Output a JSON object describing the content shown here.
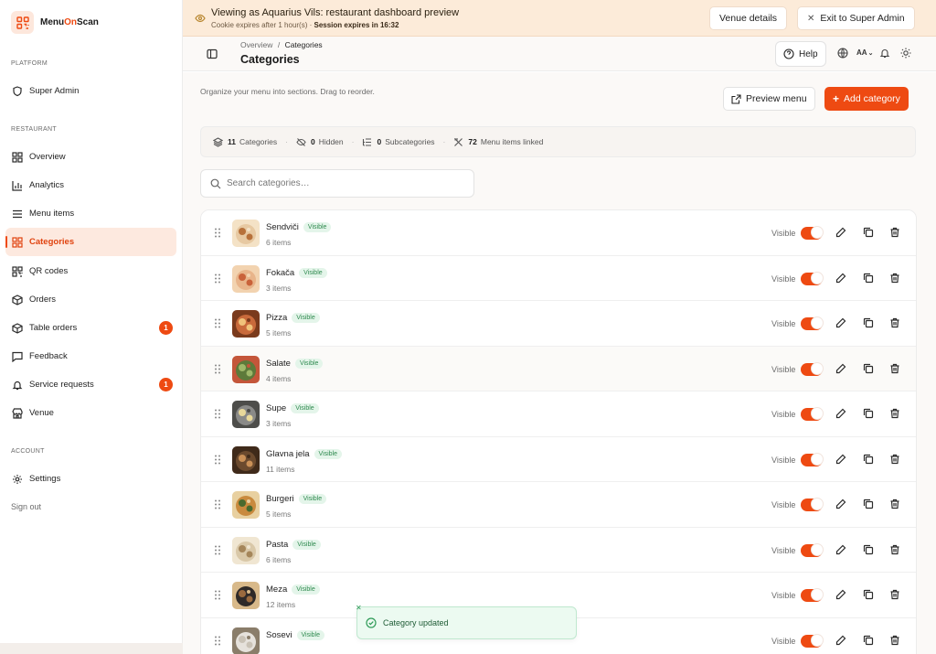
{
  "brand": {
    "name_prefix": "Menu",
    "name_accent": "On",
    "name_suffix": "Scan"
  },
  "sidebar": {
    "sections": {
      "platform": "PLATFORM",
      "restaurant": "RESTAURANT",
      "account": "ACCOUNT"
    },
    "platform_items": [
      {
        "label": "Super Admin",
        "icon": "shield-icon"
      }
    ],
    "restaurant_items": [
      {
        "label": "Overview",
        "icon": "grid-icon"
      },
      {
        "label": "Analytics",
        "icon": "bar-chart-icon"
      },
      {
        "label": "Menu items",
        "icon": "list-icon"
      },
      {
        "label": "Categories",
        "icon": "grid-icon",
        "active": true
      },
      {
        "label": "QR codes",
        "icon": "qr-icon"
      },
      {
        "label": "Orders",
        "icon": "package-icon"
      },
      {
        "label": "Table orders",
        "icon": "box-icon",
        "badge": "1"
      },
      {
        "label": "Feedback",
        "icon": "message-icon"
      },
      {
        "label": "Service requests",
        "icon": "bell-icon",
        "badge": "1"
      },
      {
        "label": "Venue",
        "icon": "store-icon"
      }
    ],
    "account_items": [
      {
        "label": "Settings",
        "icon": "gear-icon"
      }
    ],
    "sign_out": "Sign out"
  },
  "banner": {
    "title": "Viewing as Aquarius Vils: restaurant dashboard preview",
    "sub_prefix": "Cookie expires after 1 hour(s) · ",
    "sub_bold": "Session expires in 16:32",
    "venue_details": "Venue details",
    "exit": "Exit to Super Admin"
  },
  "header": {
    "crumb_root": "Overview",
    "crumb_sep": "/",
    "crumb_current": "Categories",
    "title": "Categories",
    "help": "Help",
    "font_size_label": "AA"
  },
  "content": {
    "intro": "Organize your menu into sections. Drag to reorder.",
    "preview_menu": "Preview menu",
    "add_category": "Add category",
    "stats": [
      {
        "value": "11",
        "label": "Categories",
        "icon": "layers-icon"
      },
      {
        "value": "0",
        "label": "Hidden",
        "icon": "eye-off-icon"
      },
      {
        "value": "0",
        "label": "Subcategories",
        "icon": "list-tree-icon"
      },
      {
        "value": "72",
        "label": "Menu items linked",
        "icon": "utensils-icon"
      }
    ],
    "search_placeholder": "Search categories…",
    "visible_label": "Visible"
  },
  "categories": [
    {
      "name": "Sendviči",
      "count": "6 items",
      "badge": "Visible",
      "visible": true
    },
    {
      "name": "Fokača",
      "count": "3 items",
      "badge": "Visible",
      "visible": true
    },
    {
      "name": "Pizza",
      "count": "5 items",
      "badge": "Visible",
      "visible": true
    },
    {
      "name": "Salate",
      "count": "4 items",
      "badge": "Visible",
      "visible": true
    },
    {
      "name": "Supe",
      "count": "3 items",
      "badge": "Visible",
      "visible": true
    },
    {
      "name": "Glavna jela",
      "count": "11 items",
      "badge": "Visible",
      "visible": true
    },
    {
      "name": "Burgeri",
      "count": "5 items",
      "badge": "Visible",
      "visible": true
    },
    {
      "name": "Pasta",
      "count": "6 items",
      "badge": "Visible",
      "visible": true
    },
    {
      "name": "Meza",
      "count": "12 items",
      "badge": "Visible",
      "visible": true
    },
    {
      "name": "Sosevi",
      "count": "",
      "badge": "Visible",
      "visible": true
    }
  ],
  "toast": {
    "message": "Category updated"
  },
  "colors": {
    "accent": "#ee4a12",
    "banner_bg": "#fcebd9",
    "success": "#2f9b58"
  }
}
